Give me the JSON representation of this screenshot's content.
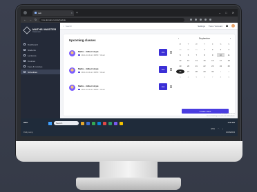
{
  "browser": {
    "tab_title": "Lab",
    "url": "lms.domain.com/schedule",
    "nav_back": "←",
    "nav_forward": "→",
    "nav_reload": "↻",
    "window_controls": [
      "–",
      "□",
      "✕"
    ]
  },
  "app": {
    "brand": "MATHS MASTER",
    "brand_sub": "Classroom"
  },
  "sidebar": {
    "items": [
      {
        "label": "Dashboard",
        "icon": "dashboard-icon"
      },
      {
        "label": "Students",
        "icon": "students-icon"
      },
      {
        "label": "Lecturers",
        "icon": "lecturers-icon"
      },
      {
        "label": "Courses",
        "icon": "courses-icon"
      },
      {
        "label": "Fees & Invoices",
        "icon": "invoice-icon"
      },
      {
        "label": "Schedules",
        "icon": "calendar-icon",
        "active": true
      }
    ]
  },
  "topbar": {
    "search_placeholder": "Search",
    "settings": "Settings",
    "user": "Tutor / Account"
  },
  "upcoming": {
    "heading": "Upcoming classes",
    "classes": [
      {
        "title": "Maths - Gilbert Joyle",
        "datetime": "2021-10-10 at 4:00PM",
        "mode": "Virtual",
        "action": "Join"
      },
      {
        "title": "Maths - Gilbert Joyle",
        "datetime": "2021-10-10 at 4:00PM",
        "mode": "Virtual",
        "action": "Join"
      },
      {
        "title": "Maths - Gilbert Joyle",
        "datetime": "2021-10-10 at 4:00PM",
        "mode": "Virtual",
        "action": "Join"
      }
    ]
  },
  "calendar": {
    "prev": "‹",
    "next": "›",
    "month": "September",
    "weekdays": [
      "M",
      "T",
      "W",
      "T",
      "F",
      "S",
      "S"
    ],
    "days": [
      [
        "29",
        "30",
        "31",
        "1",
        "2",
        "3",
        "4"
      ],
      [
        "5",
        "6",
        "7",
        "8",
        "9",
        "10",
        "11"
      ],
      [
        "12",
        "13",
        "14",
        "15",
        "16",
        "17",
        "18"
      ],
      [
        "19",
        "20",
        "21",
        "22",
        "23",
        "24",
        "25"
      ],
      [
        "26",
        "27",
        "28",
        "29",
        "30",
        "1",
        "2"
      ],
      [
        "3",
        "4",
        "5",
        "6",
        "7",
        "8",
        "9"
      ]
    ],
    "selected_day": "10",
    "today": "26",
    "create_button": "Create class"
  },
  "watermark": {
    "line1": "Activate Windows",
    "line2": "Go to Settings to activate Windows."
  },
  "taskbar": {
    "weather_temp": "28°F",
    "weather_desc": "Partly sunny",
    "search": "Search",
    "tray_lang": "ENG",
    "time": "4:38 PM",
    "date": "10/26/2023"
  },
  "colors": {
    "accent": "#3b2fd6",
    "sidebar": "#242a38",
    "taskbar": "#1f2b3a"
  }
}
